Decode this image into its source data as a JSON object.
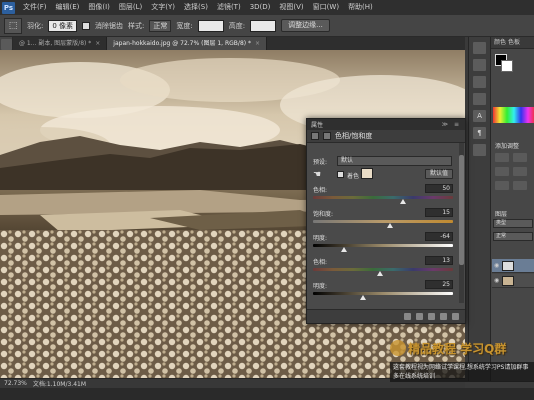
{
  "app": {
    "logo": "Ps",
    "menus": [
      "文件(F)",
      "编辑(E)",
      "图像(I)",
      "图层(L)",
      "文字(Y)",
      "选择(S)",
      "滤镜(T)",
      "3D(D)",
      "视图(V)",
      "窗口(W)",
      "帮助(H)"
    ]
  },
  "options": {
    "feather_label": "羽化:",
    "feather_value": "0 像素",
    "antialias_label": "消除锯齿",
    "style_label": "样式:",
    "style_value": "正常",
    "width_label": "宽度:",
    "height_label": "高度:",
    "refine_button": "调整边缘..."
  },
  "tabs": [
    {
      "label": "@ 1... 副本, 图层蒙版/8) *",
      "active": false
    },
    {
      "label": "japan-hokkaido.jpg @ 72.7% (图层 1, RGB/8) *",
      "active": true
    }
  ],
  "status": {
    "zoom": "72.73%",
    "doc": "文档:1.10M/3.41M"
  },
  "hsl_panel": {
    "header_title": "属性",
    "header_buttons": "≫ ≡",
    "title": "色相/饱和度",
    "preset_label": "预设:",
    "preset_value": "默认",
    "colorize_label": "着色",
    "default_button": "默认值",
    "sliders": [
      {
        "label": "色相:",
        "value": "50",
        "fraction": 0.64
      },
      {
        "label": "饱和度:",
        "value": "15",
        "fraction": 0.55
      },
      {
        "label": "明度:",
        "value": "-64",
        "fraction": 0.22
      },
      {
        "label": "色相:",
        "value": "13",
        "fraction": 0.48
      },
      {
        "label": "明度:",
        "value": "25",
        "fraction": 0.36
      }
    ],
    "colors": {
      "track_hue": "linear-gradient(90deg,#6b3a3a,#7a5a3a,#6b6b3a,#3a6b3a,#3a6b6b,#3a3a6b,#6b3a6b,#6b3a3a)",
      "track_sat": "linear-gradient(90deg,#777,#b89a6a,#c08a30)",
      "track_light": "linear-gradient(90deg,#000,#9a8a6a,#fff)"
    }
  },
  "dock": {
    "tab_color": "颜色",
    "tab_swatches": "色板",
    "adjustments_label": "添加调整",
    "layers_label": "图层",
    "kind_select": "类型",
    "blend_select": "正常"
  },
  "watermark": {
    "title": "精品教程 学习Q群",
    "caption": "这套教程视为网络试学课程,想系统学习PS请加群事多在线系统培训"
  }
}
